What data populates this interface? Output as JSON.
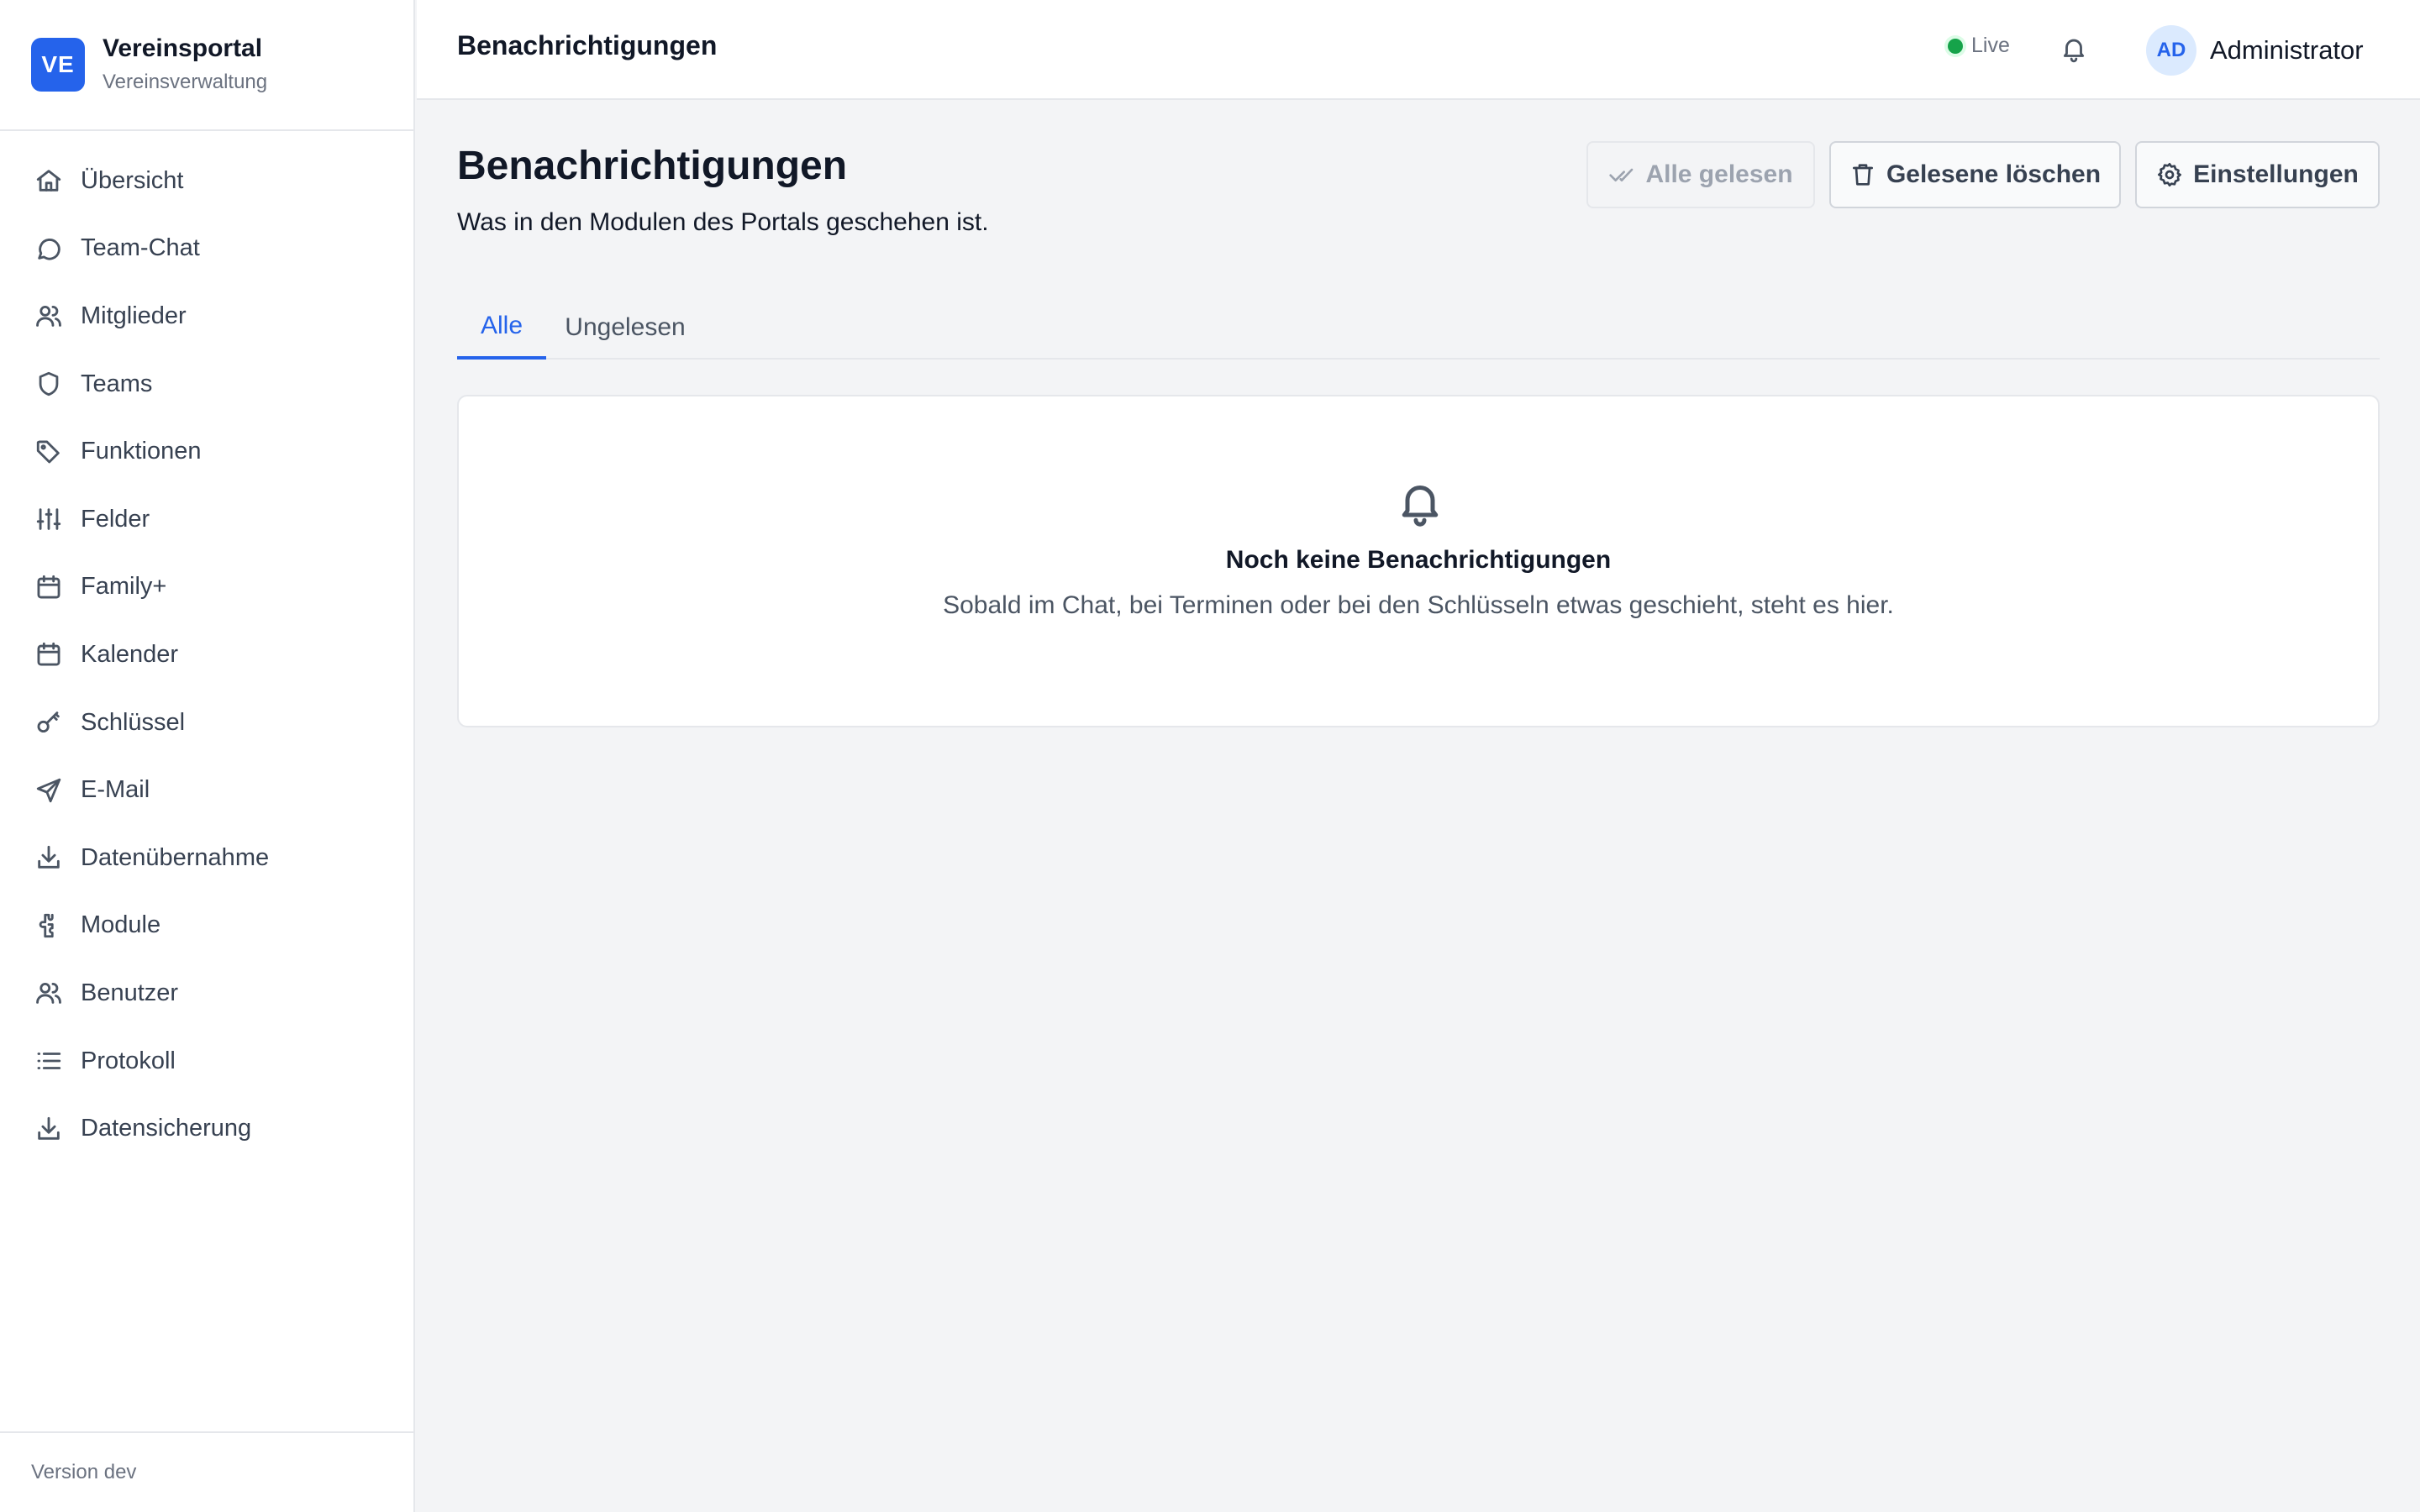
{
  "brand": {
    "logo_text": "VE",
    "name": "Vereinsportal",
    "subtitle": "Vereinsverwaltung",
    "accent": "#2563eb"
  },
  "sidebar": {
    "items": [
      {
        "label": "Übersicht",
        "icon": "home-icon"
      },
      {
        "label": "Team-Chat",
        "icon": "chat-bubble-icon"
      },
      {
        "label": "Mitglieder",
        "icon": "users-icon"
      },
      {
        "label": "Teams",
        "icon": "shield-icon"
      },
      {
        "label": "Funktionen",
        "icon": "tag-icon"
      },
      {
        "label": "Felder",
        "icon": "sliders-icon"
      },
      {
        "label": "Family+",
        "icon": "calendar-icon"
      },
      {
        "label": "Kalender",
        "icon": "calendar-icon"
      },
      {
        "label": "Schlüssel",
        "icon": "key-icon"
      },
      {
        "label": "E-Mail",
        "icon": "send-icon"
      },
      {
        "label": "Datenübernahme",
        "icon": "download-icon"
      },
      {
        "label": "Module",
        "icon": "puzzle-icon"
      },
      {
        "label": "Benutzer",
        "icon": "users-icon"
      },
      {
        "label": "Protokoll",
        "icon": "list-icon"
      },
      {
        "label": "Datensicherung",
        "icon": "download-icon"
      }
    ],
    "footer": "Version dev"
  },
  "topbar": {
    "title": "Benachrichtigungen",
    "live_label": "Live",
    "live_color": "#16a34a",
    "user_initials": "AD",
    "user_name": "Administrator"
  },
  "main": {
    "title": "Benachrichtigungen",
    "subtitle": "Was in den Modulen des Portals geschehen ist.",
    "actions": {
      "mark_all_read": "Alle gelesen",
      "delete_read": "Gelesene löschen",
      "settings": "Einstellungen"
    },
    "tabs": [
      {
        "label": "Alle",
        "active": true
      },
      {
        "label": "Ungelesen",
        "active": false
      }
    ],
    "empty": {
      "title": "Noch keine Benachrichtigungen",
      "text": "Sobald im Chat, bei Terminen oder bei den Schlüsseln etwas geschieht, steht es hier."
    }
  }
}
